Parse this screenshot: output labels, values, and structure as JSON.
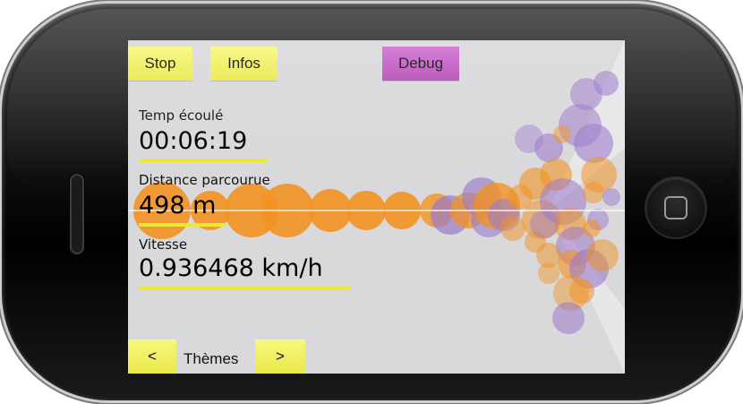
{
  "toolbar": {
    "stop_label": "Stop",
    "infos_label": "Infos",
    "debug_label": "Debug"
  },
  "stats": {
    "elapsed_label": "Temp écoulé",
    "elapsed_value": "00:06:19",
    "distance_label": "Distance parcourue",
    "distance_value": "498 m",
    "speed_label": "Vitesse",
    "speed_value": "0.936468 km/h"
  },
  "themes": {
    "prev_label": "<",
    "title": "Thèmes",
    "next_label": ">"
  },
  "colors": {
    "button_yellow": "#f2f15e",
    "button_purple": "#c35fc6",
    "underline_yellow": "#ebe836",
    "bubble_orange": "#f29222",
    "bubble_purple": "#9b79c9",
    "screen_bg": "#d9d9dc"
  },
  "icons": [
    "home-square-icon",
    "speaker-grille"
  ]
}
